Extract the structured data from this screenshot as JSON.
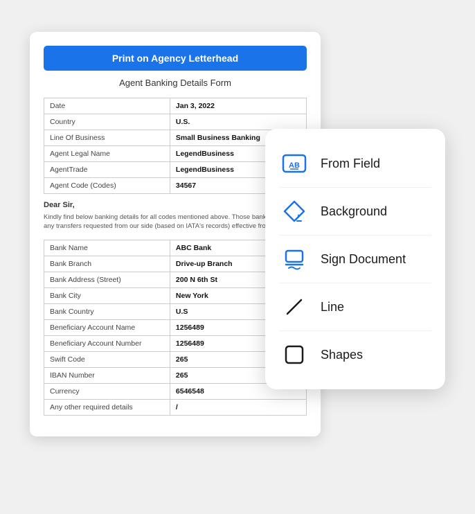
{
  "document": {
    "print_button": "Print on Agency Letterhead",
    "title": "Agent Banking Details Form",
    "fields": [
      {
        "label": "Date",
        "value": "Jan 3, 2022"
      },
      {
        "label": "Country",
        "value": "U.S."
      },
      {
        "label": "Line Of Business",
        "value": "Small Business Banking"
      },
      {
        "label": "Agent Legal Name",
        "value": "LegendBusiness"
      },
      {
        "label": "AgentTrade",
        "value": "LegendBusiness"
      },
      {
        "label": "Agent Code (Codes)",
        "value": "34567"
      }
    ],
    "salutation": "Dear Sir,",
    "body_text": "Kindly find below banking details for all codes mentioned above. Those banking det... for any transfers requested from our side (based on IATA's records) effective from d...",
    "bank_fields": [
      {
        "label": "Bank Name",
        "value": "ABC Bank"
      },
      {
        "label": "Bank Branch",
        "value": "Drive-up Branch"
      },
      {
        "label": "Bank Address (Street)",
        "value": "200 N 6th St"
      },
      {
        "label": "Bank City",
        "value": "New York"
      },
      {
        "label": "Bank Country",
        "value": "U.S"
      },
      {
        "label": "Beneficiary Account Name",
        "value": "1256489"
      },
      {
        "label": "Beneficiary Account Number",
        "value": "1256489"
      },
      {
        "label": "Swift Code",
        "value": "265"
      },
      {
        "label": "IBAN Number",
        "value": "265"
      },
      {
        "label": "Currency",
        "value": "6546548"
      },
      {
        "label": "Any other required details",
        "value": "/"
      }
    ]
  },
  "menu": {
    "items": [
      {
        "id": "from-field",
        "label": "From Field",
        "icon": "from-field-icon"
      },
      {
        "id": "background",
        "label": "Background",
        "icon": "background-icon"
      },
      {
        "id": "sign-document",
        "label": "Sign Document",
        "icon": "sign-document-icon"
      },
      {
        "id": "line",
        "label": "Line",
        "icon": "line-icon"
      },
      {
        "id": "shapes",
        "label": "Shapes",
        "icon": "shapes-icon"
      }
    ]
  }
}
